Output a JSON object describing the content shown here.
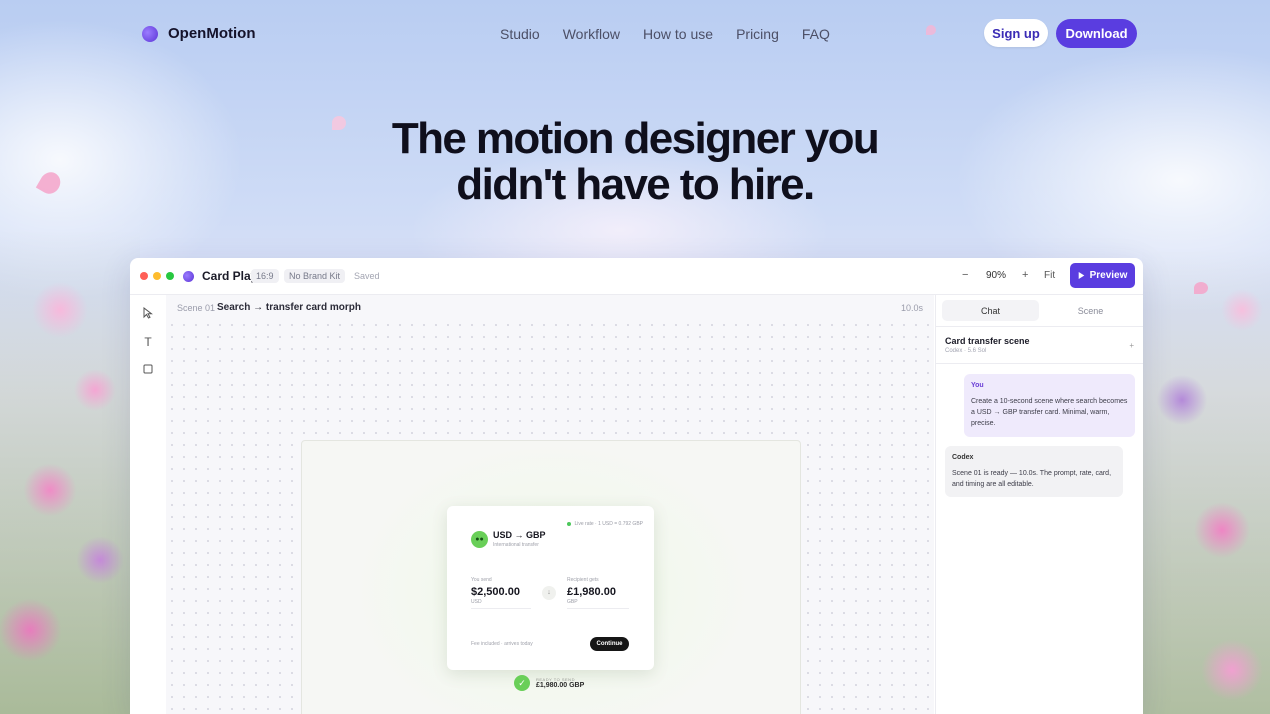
{
  "nav": {
    "brand": "OpenMotion",
    "links": [
      "Studio",
      "Workflow",
      "How to use",
      "Pricing",
      "FAQ"
    ],
    "signup_label": "Sign up",
    "download_label": "Download"
  },
  "hero": {
    "line1": "The motion designer you",
    "line2": "didn't have to hire."
  },
  "app": {
    "project_name": "Card Play",
    "aspect_chip": "16:9",
    "brand_chip": "No Brand Kit",
    "save_status": "Saved",
    "zoom_minus": "−",
    "zoom_level": "90%",
    "zoom_plus": "+",
    "fit_label": "Fit",
    "preview_label": "Preview",
    "scene": {
      "number": "Scene 01",
      "title": "Search → transfer card morph",
      "duration": "10.0s"
    },
    "card": {
      "live_rate": "Live rate · 1 USD = 0.792 GBP",
      "flag_glyph": "●●",
      "pair": "USD → GBP",
      "pair_sub": "International transfer",
      "send_label": "You send",
      "send_amount": "$2,500.00",
      "send_currency": "USD",
      "swap_glyph": "↓",
      "receive_label": "Recipient gets",
      "receive_amount": "£1,980.00",
      "receive_currency": "GBP",
      "fee_note": "Fee included · arrives today",
      "continue_label": "Continue"
    },
    "ready": {
      "label": "READY TO SEND",
      "amount": "£1,980.00 GBP"
    },
    "panel": {
      "tab_chat": "Chat",
      "tab_scene": "Scene",
      "title": "Card transfer scene",
      "subtitle": "Codex · 5.6 Sol",
      "plus": "+",
      "messages": [
        {
          "author": "You",
          "text": "Create a 10-second scene where search becomes a USD → GBP transfer card. Minimal, warm, precise."
        },
        {
          "author": "Codex",
          "text": "Scene 01 is ready — 10.0s. The prompt, rate, card, and timing are all editable."
        }
      ]
    }
  },
  "icons": {
    "pointer": "pointer-icon",
    "text": "text-tool-icon",
    "rect": "rectangle-tool-icon",
    "play": "play-icon",
    "check": "check-icon"
  },
  "colors": {
    "accent": "#5a3de0",
    "success": "#69cf58",
    "dot_red": "#ff5f57",
    "dot_yellow": "#febc2e",
    "dot_green": "#28c840"
  }
}
